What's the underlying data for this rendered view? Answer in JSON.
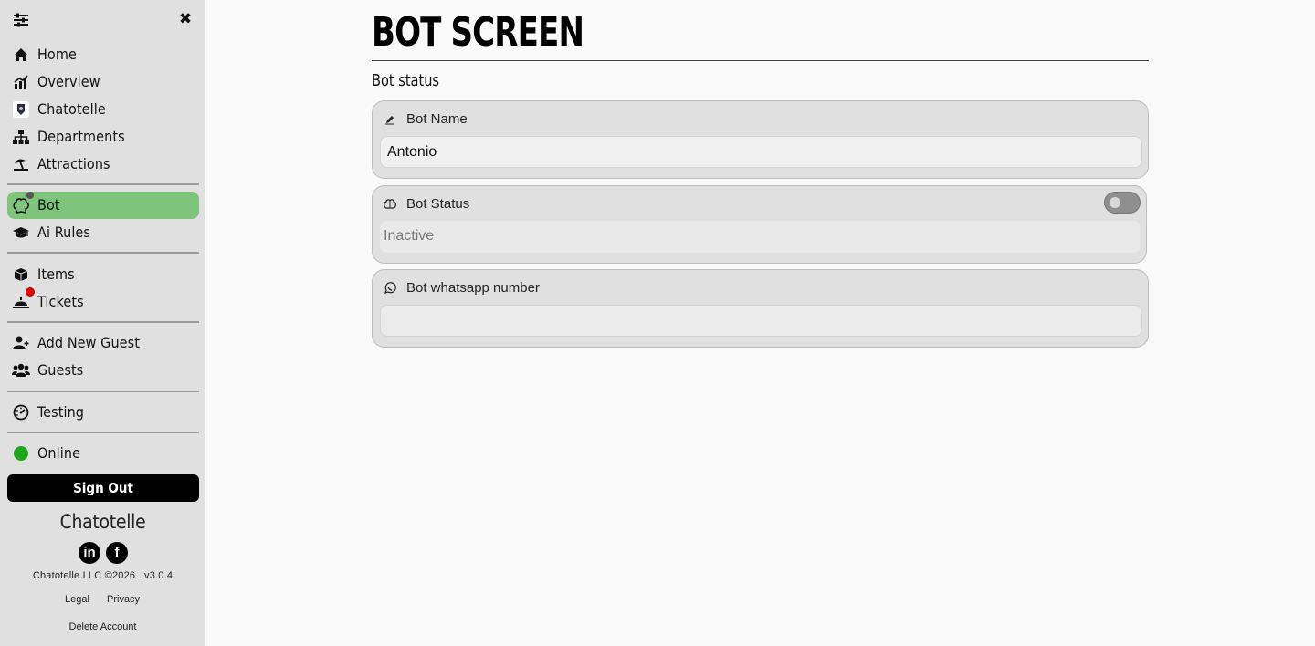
{
  "sidebar": {
    "menu_icon": "sliders-icon",
    "close_icon": "close-x-icon",
    "items": [
      {
        "label": "Home",
        "icon": "home-icon"
      },
      {
        "label": "Overview",
        "icon": "chart-icon"
      },
      {
        "label": "Chatotelle",
        "icon": "chatotelle-logo-icon"
      },
      {
        "label": "Departments",
        "icon": "sitemap-icon"
      },
      {
        "label": "Attractions",
        "icon": "umbrella-beach-icon"
      },
      {
        "label": "Bot",
        "icon": "brain-icon",
        "active": true
      },
      {
        "label": "Ai Rules",
        "icon": "graduation-cap-icon"
      },
      {
        "label": "Items",
        "icon": "boxes-icon"
      },
      {
        "label": "Tickets",
        "icon": "bell-concierge-icon"
      },
      {
        "label": "Add New Guest",
        "icon": "user-plus-icon"
      },
      {
        "label": "Guests",
        "icon": "users-icon"
      },
      {
        "label": "Testing",
        "icon": "gauge-icon"
      },
      {
        "label": "Online",
        "icon": "status-dot-icon"
      }
    ],
    "sign_out": "Sign Out",
    "brand": "Chatotelle",
    "social": [
      "linkedin-icon",
      "facebook-icon"
    ],
    "copyright": "Chatotelle.LLC ©2026 . v3.0.4",
    "legal": "Legal",
    "privacy": "Privacy",
    "delete_account": "Delete Account"
  },
  "main": {
    "title": "BOT SCREEN",
    "section": "Bot status",
    "bot_name": {
      "label": "Bot Name",
      "value": "Antonio",
      "icon": "pen-icon"
    },
    "bot_status": {
      "label": "Bot Status",
      "value": "Inactive",
      "icon": "brain-icon",
      "toggle_on": false
    },
    "bot_whatsapp": {
      "label": "Bot whatsapp number",
      "value": "",
      "icon": "whatsapp-icon"
    }
  },
  "colors": {
    "active_nav": "#7ec47a",
    "online": "#1fa61f",
    "badge": "#e00000",
    "sidebar_bg": "#e0e0e0"
  }
}
